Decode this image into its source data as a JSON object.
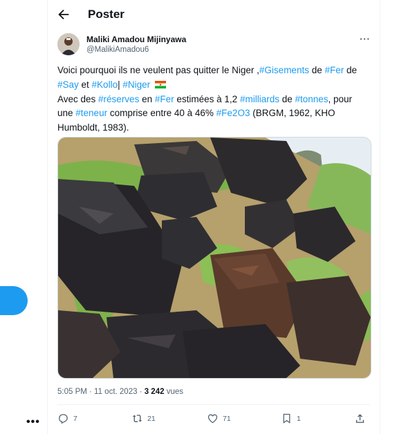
{
  "header": {
    "title": "Poster"
  },
  "author": {
    "name": "Maliki Amadou Mijinyawa",
    "handle": "@MalikiAmadou6"
  },
  "tweet": {
    "l1_a": "Voici pourquoi ils ne veulent pas quitter le Niger ,",
    "l1_tag_gisements": "#Gisements",
    "l1_b": " de ",
    "l1_tag_fer": "#Fer",
    "l1_c": " de",
    "l2_tag_say": "#Say",
    "l2_a": " et ",
    "l2_tag_kollo": "#Kollo",
    "l2_b": "| ",
    "l2_tag_niger": "#Niger",
    "l3_a": "Avec des ",
    "l3_tag_reserves": "#réserves",
    "l3_b": " en ",
    "l3_tag_fer": "#Fer",
    "l3_c": " estimées à 1,2 ",
    "l3_tag_milliards": "#milliards",
    "l3_d": " de ",
    "l3_tag_tonnes": "#tonnes",
    "l3_e": ", pour",
    "l4_a": "une ",
    "l4_tag_teneur": "#teneur",
    "l4_b": " comprise entre 40 à 46% ",
    "l4_tag_fe2o3": "#Fe2O3",
    "l4_c": " (BRGM, 1962, KHO",
    "l5": "Humboldt, 1983)."
  },
  "meta": {
    "time": "5:05 PM · 11 oct. 2023 · ",
    "views_count": "3 242",
    "views_label": " vues"
  },
  "actions": {
    "replies": "7",
    "reposts": "21",
    "likes": "71",
    "bookmarks": "1"
  },
  "colors": {
    "accent": "#1d9bf0",
    "secondary_text": "#536471"
  }
}
